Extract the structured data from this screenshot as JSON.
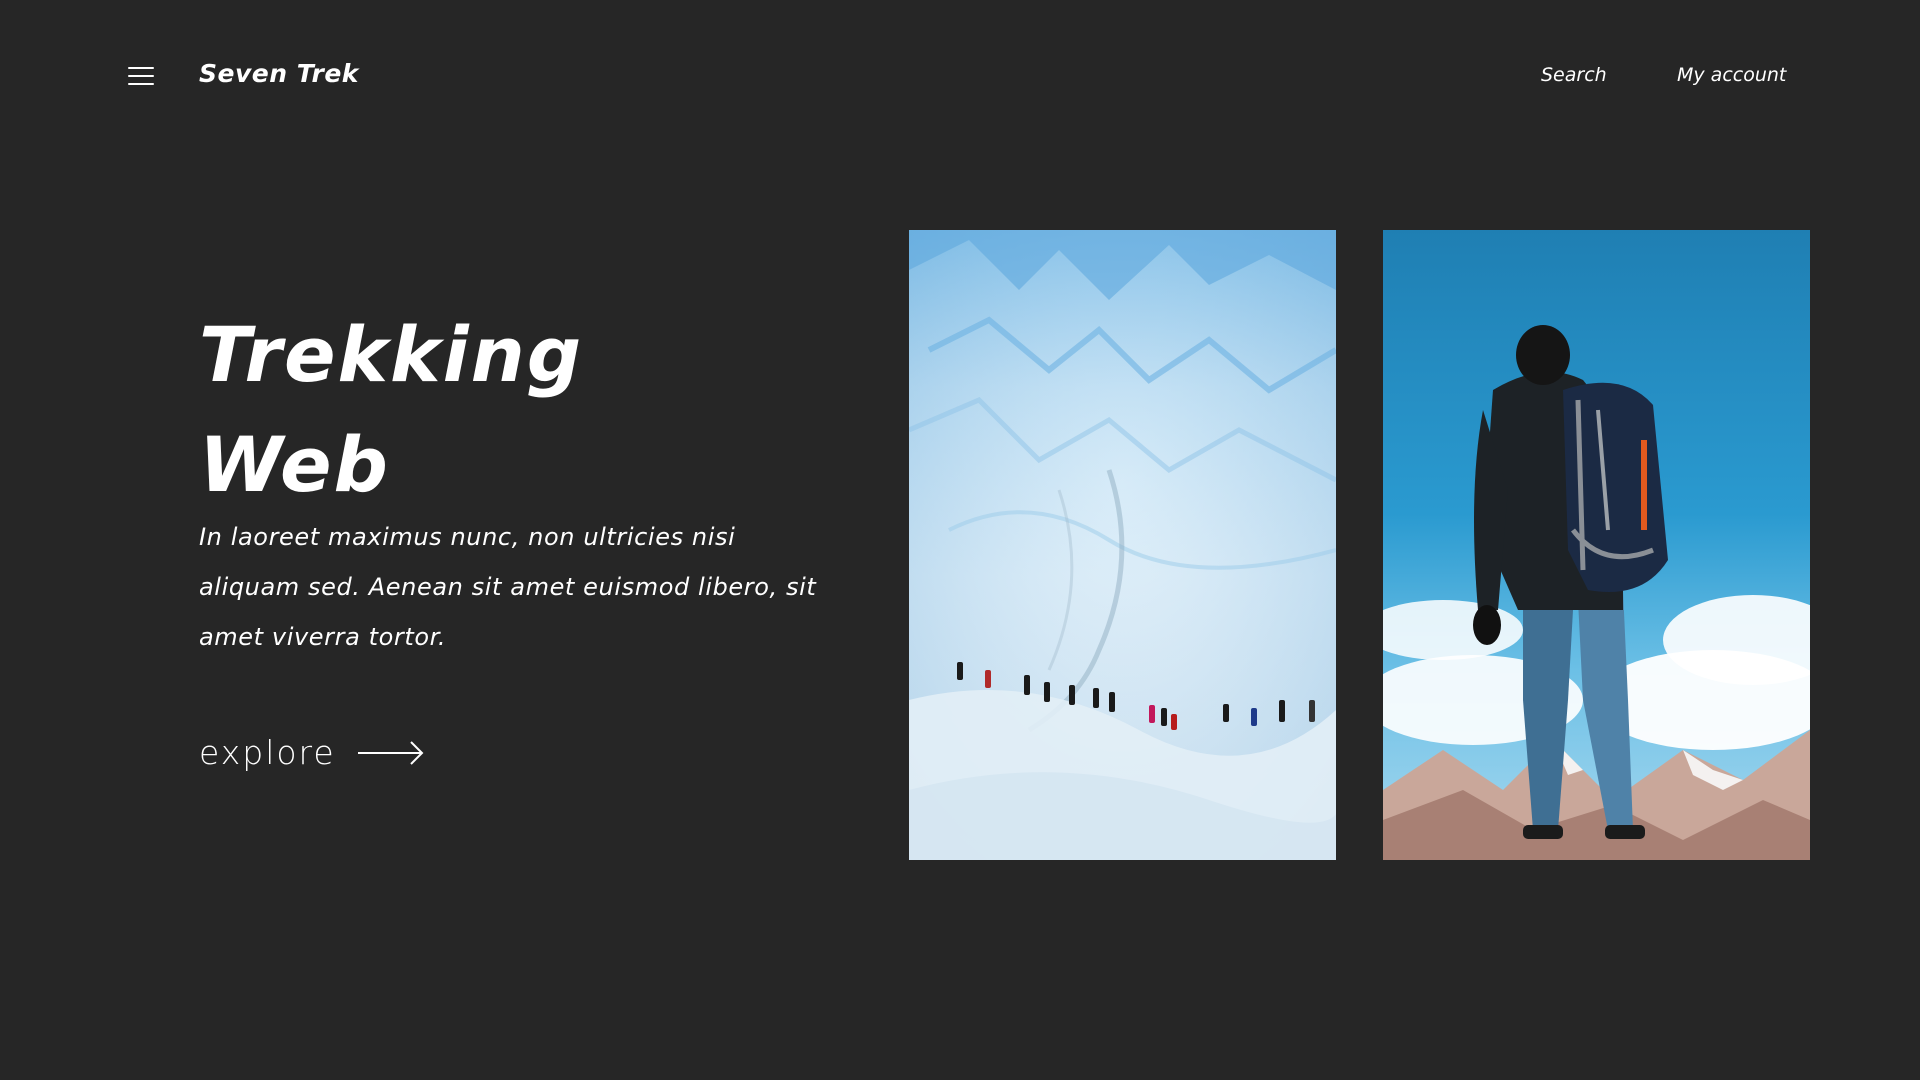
{
  "header": {
    "brand": "Seven Trek",
    "nav": {
      "search": "Search",
      "account": "My account"
    },
    "menu_icon": "hamburger-menu-icon"
  },
  "hero": {
    "title_line1": "Trekking",
    "title_line2": "Web",
    "description": "In laoreet maximus nunc, non ultricies nisi aliquam sed. Aenean sit amet euismod libero, sit amet viverra tortor.",
    "cta_label": "explore",
    "cta_icon": "arrow-right-icon"
  },
  "images": {
    "glacier": "glacier-hikers-image",
    "hiker": "backpacker-mountain-image"
  },
  "colors": {
    "background": "#262626",
    "text": "#ffffff"
  }
}
